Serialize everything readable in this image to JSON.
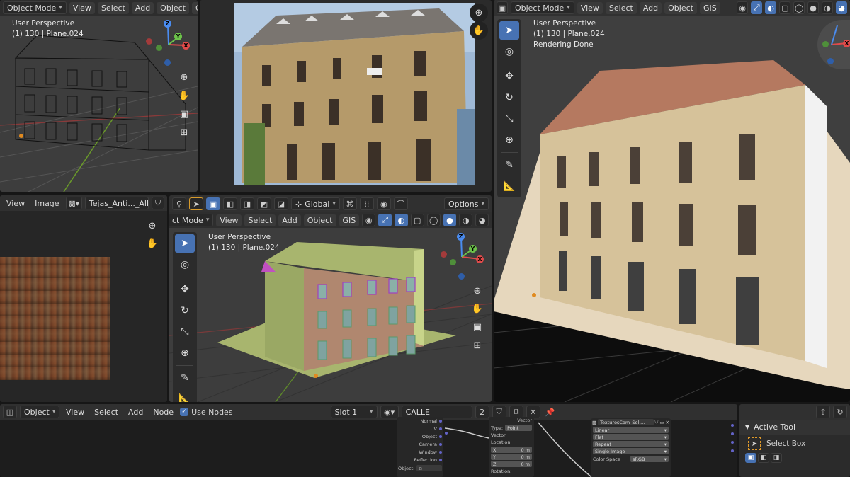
{
  "top_left_viewport": {
    "mode": "Object Mode",
    "menus": [
      "View",
      "Select",
      "Add",
      "Object",
      "GIS"
    ],
    "overlay_title": "User Perspective",
    "overlay_object": "(1) 130 | Plane.024",
    "axes": {
      "z": "Z",
      "y": "Y",
      "x": "X"
    }
  },
  "photo_view": {
    "description_icon_names": [
      "zoom-in-icon",
      "pan-hand-icon"
    ]
  },
  "render_viewport": {
    "mode": "Object Mode",
    "menus": [
      "View",
      "Select",
      "Add",
      "Object",
      "GIS"
    ],
    "overlay_title": "User Perspective",
    "overlay_object": "(1) 130 | Plane.024",
    "overlay_status": "Rendering Done"
  },
  "image_editor": {
    "menus": [
      "View",
      "Image"
    ],
    "image_name": "Tejas_Anti..._Albedo.tif"
  },
  "center_viewport": {
    "header": {
      "orientation": "Global",
      "options_label": "Options"
    },
    "mode": "ct Mode",
    "menus": [
      "View",
      "Select",
      "Add",
      "Object",
      "GIS"
    ],
    "overlay_title": "User Perspective",
    "overlay_object": "(1) 130 | Plane.024",
    "axes": {
      "z": "Z",
      "y": "Y",
      "x": "X"
    }
  },
  "node_editor": {
    "mode": "Object",
    "menus": [
      "View",
      "Select",
      "Add",
      "Node"
    ],
    "use_nodes_label": "Use Nodes",
    "slot": "Slot 1",
    "material_name": "CALLE",
    "user_count": "2",
    "texcoord_outputs": [
      "Normal",
      "UV",
      "Object",
      "Camera",
      "Window",
      "Reflection"
    ],
    "object_label": "Object:",
    "mapping": {
      "header": "Vector",
      "type_label": "Type:",
      "type_value": "Point",
      "vector_label": "Vector",
      "location_label": "Location:",
      "fields": [
        {
          "axis": "X",
          "value": "0 m"
        },
        {
          "axis": "Y",
          "value": "0 m"
        },
        {
          "axis": "Z",
          "value": "0 m"
        }
      ],
      "rotation_label": "Rotation:"
    },
    "image_texture": {
      "name": "TexturesCom_Soli...",
      "interpolation": "Linear",
      "projection": "Flat",
      "extension": "Repeat",
      "source": "Single Image",
      "color_space_label": "Color Space",
      "color_space_value": "sRGB"
    }
  },
  "sidebar": {
    "section_title": "Active Tool",
    "tool_name": "Select Box"
  },
  "colors": {
    "accent": "#4772b3",
    "header": "#303030",
    "viewport": "#3d3d3d"
  }
}
